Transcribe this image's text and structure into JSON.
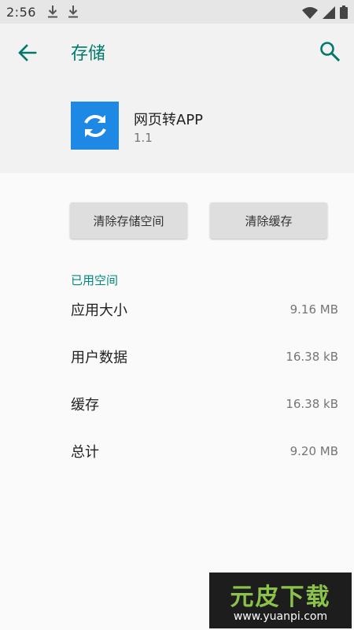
{
  "status_bar": {
    "time": "2:56",
    "icons": [
      "download-icon",
      "download-icon",
      "wifi-icon",
      "signal-icon",
      "battery-icon"
    ]
  },
  "app_bar": {
    "title": "存储",
    "back_icon": "arrow-back-icon",
    "search_icon": "search-icon",
    "accent_color": "#00796b"
  },
  "app_info": {
    "name": "网页转APP",
    "version": "1.1",
    "icon": "sync-icon",
    "icon_color": "#1e88e5"
  },
  "buttons": {
    "clear_storage": "清除存储空间",
    "clear_cache": "清除缓存"
  },
  "storage": {
    "section_title": "已用空间",
    "rows": [
      {
        "label": "应用大小",
        "value": "9.16 MB"
      },
      {
        "label": "用户数据",
        "value": "16.38 kB"
      },
      {
        "label": "缓存",
        "value": "16.38 kB"
      },
      {
        "label": "总计",
        "value": "9.20 MB"
      }
    ]
  },
  "watermark": {
    "title": "元皮下载",
    "url": "www.yuanpi.com"
  }
}
